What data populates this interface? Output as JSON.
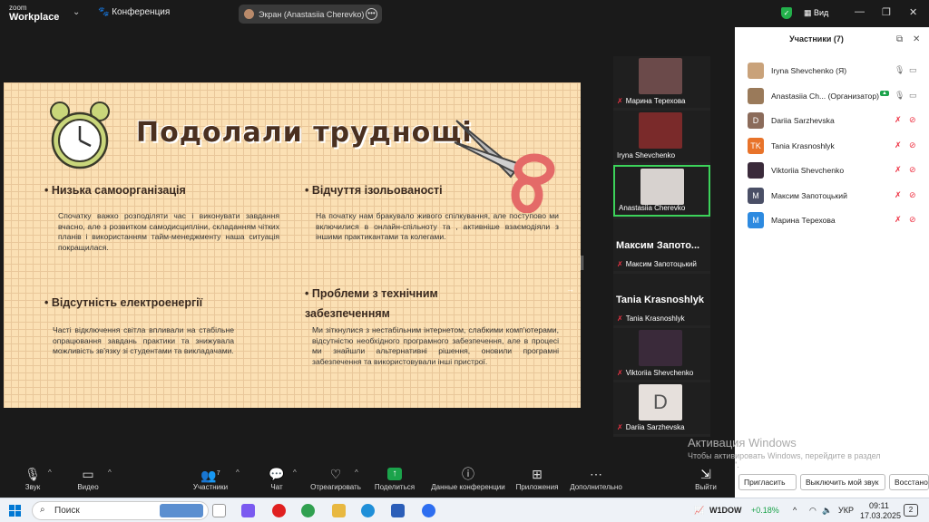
{
  "app": {
    "logo_line1": "zoom",
    "logo_line2": "Workplace",
    "conference_label": "Конференция",
    "screen_share_label": "Экран (Anastasiia Cherevko)",
    "view_label": "Вид"
  },
  "slide": {
    "title": "Подолали труднощі",
    "sections": [
      {
        "heading": "• Низька самоорганізація",
        "body": "Спочатку важко розподіляти час і виконувати завдання вчасно, але з розвитком самодисципліни, складанням чітких планів і використанням тайм-менеджменту наша ситуація покращилася."
      },
      {
        "heading": "• Відчуття ізольованості",
        "body": "На початку нам бракувало живого спілкування, але поступово ми включилися в онлайн-спільноту та , активніше взаємодіяли з іншими практикантами та колегами."
      },
      {
        "heading": "• Відсутність електроенергії",
        "body": "Часті відключення світла впливали на стабільне опрацювання завдань практики та знижувала можливість зв'язку зі студентами та викладачами."
      },
      {
        "heading": "• Проблеми з технічним забезпеченням",
        "body": "Ми зіткнулися з нестабільним інтернетом, слабкими комп'ютерами, відсутністю необхідного програмного забезпечення, але в процесі ми знайшли альтернативні рішення, оновили програмні забезпечення та використовували інші пристрої."
      }
    ]
  },
  "tiles": [
    {
      "name": "Марина Терехова",
      "big": ""
    },
    {
      "name": "Iryna Shevchenko",
      "big": ""
    },
    {
      "name": "Anastasiia Cherevko",
      "big": ""
    },
    {
      "name": "Максим Запотоцький",
      "big": "Максим Запото..."
    },
    {
      "name": "Tania Krasnoshlyk",
      "big": "Tania Krasnoshlyk"
    },
    {
      "name": "Viktoriia Shevchenko",
      "big": ""
    },
    {
      "name": "Dariia Sarzhevska",
      "big": ""
    }
  ],
  "dariia_initial": "D",
  "participants_panel": {
    "header": "Участники (7)",
    "list": [
      {
        "name": "Iryna Shevchenko (Я)",
        "initials": "",
        "color": "#c9a27a"
      },
      {
        "name": "Anastasiia Ch...  (Организатор)",
        "initials": "",
        "color": "#9a7a5a"
      },
      {
        "name": "Dariia Sarzhevska",
        "initials": "D",
        "color": "#8b6b5a"
      },
      {
        "name": "Tania Krasnoshlyk",
        "initials": "TK",
        "color": "#e8732a"
      },
      {
        "name": "Viktoriia Shevchenko",
        "initials": "",
        "color": "#3a2a3a"
      },
      {
        "name": "Максим Запотоцький",
        "initials": "М",
        "color": "#4a4f66"
      },
      {
        "name": "Марина Терехова",
        "initials": "М",
        "color": "#2d8ae0"
      }
    ],
    "invite": "Пригласить",
    "mute_me": "Выключить мой звук",
    "restore": "Восстановить"
  },
  "watermark": {
    "title": "Активация Windows",
    "text": "Чтобы активировать Windows, перейдите в раздел \"Параметры\"."
  },
  "toolbar": {
    "audio": "Звук",
    "video": "Видео",
    "participants": "Участники",
    "participants_count": "7",
    "chat": "Чат",
    "react": "Отреагировать",
    "share": "Поделиться",
    "info": "Данные конференции",
    "apps": "Приложения",
    "more": "Дополнительно",
    "leave": "Выйти"
  },
  "taskbar": {
    "search": "Поиск",
    "ticker": "W1DOW",
    "change": "+0.18%",
    "lang": "УКР",
    "time": "09:11",
    "date": "17.03.2025",
    "notif": "2"
  }
}
